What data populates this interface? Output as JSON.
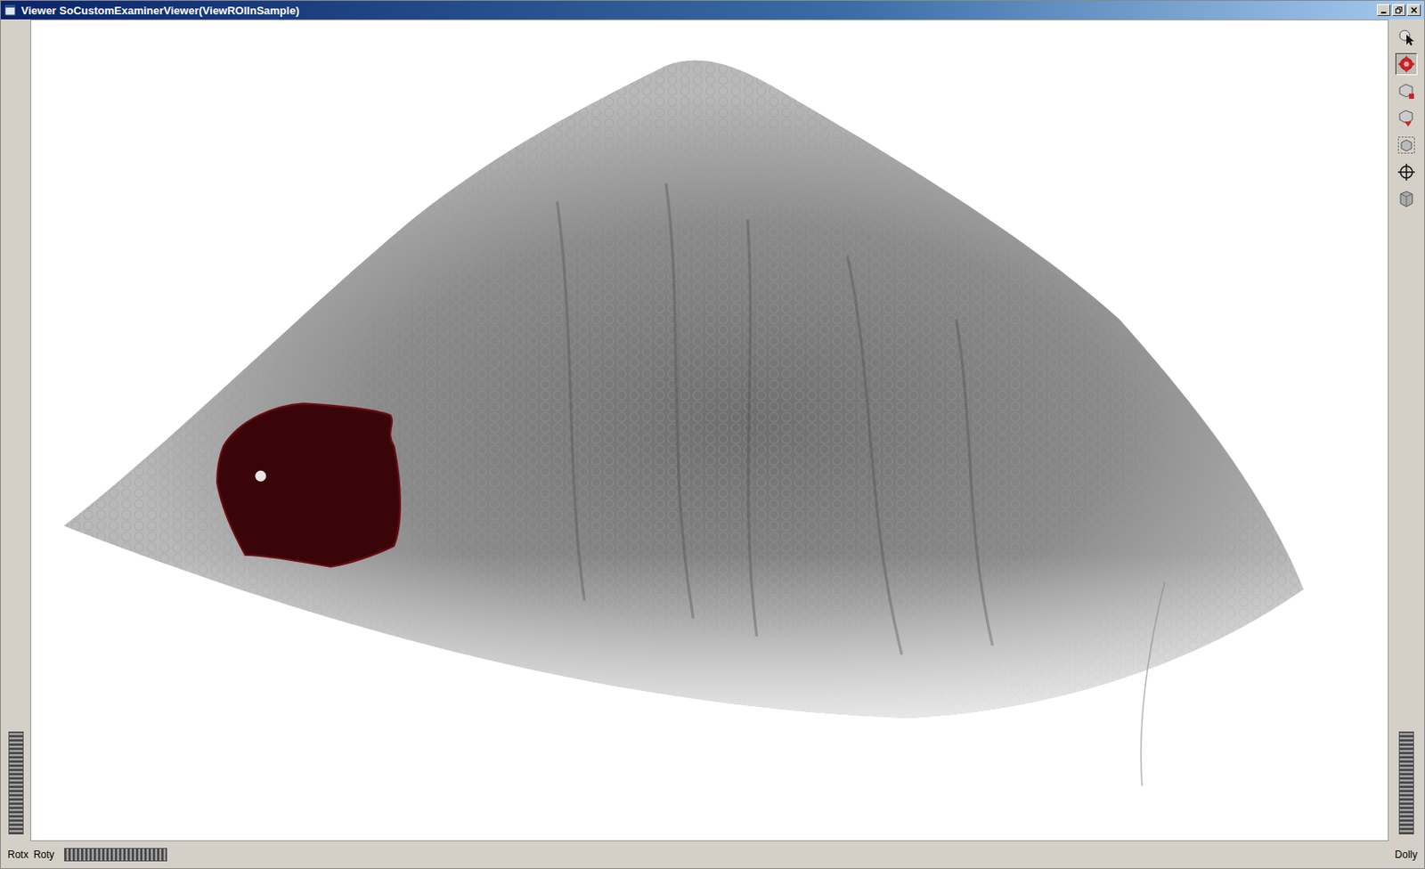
{
  "window": {
    "title": "Viewer SoCustomExaminerViewer(ViewROIInSample)"
  },
  "toolbar": {
    "tools": [
      {
        "selected": false
      },
      {
        "selected": true
      },
      {
        "selected": false
      },
      {
        "selected": false
      },
      {
        "selected": false
      },
      {
        "selected": false
      },
      {
        "selected": false
      }
    ]
  },
  "bottom_bar": {
    "left_labels": [
      "Rotx",
      "Roty"
    ],
    "right_label": "Dolly"
  }
}
